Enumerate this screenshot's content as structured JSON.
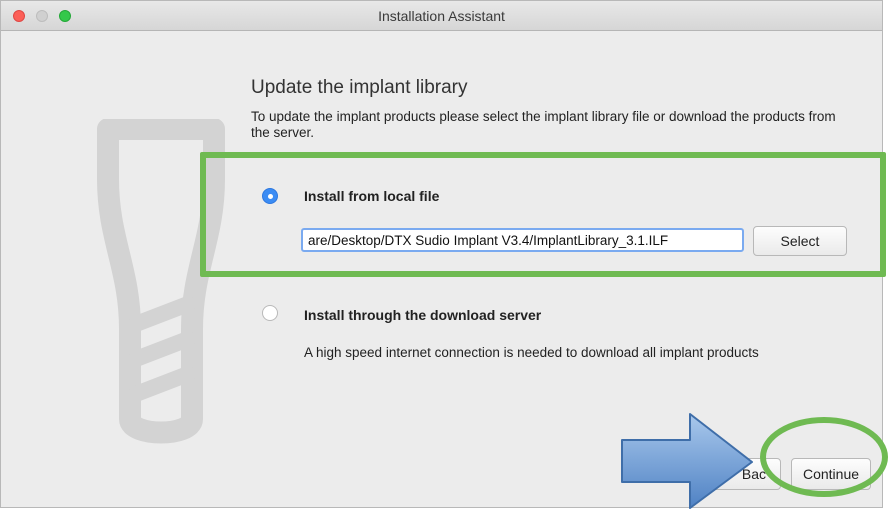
{
  "window": {
    "title": "Installation Assistant"
  },
  "page": {
    "heading": "Update the implant library",
    "description": "To update the implant products please select the implant library file or download the products from the server."
  },
  "options": {
    "local": {
      "label": "Install from local file",
      "selected": true,
      "file_path": "are/Desktop/DTX Sudio Implant V3.4/ImplantLibrary_3.1.ILF",
      "select_label": "Select"
    },
    "server": {
      "label": "Install through the download server",
      "selected": false,
      "description": "A high speed internet connection is needed to download all implant products"
    }
  },
  "footer": {
    "back_label": "Bac",
    "continue_label": "Continue"
  },
  "annotations": {
    "highlight_color": "#6fba52",
    "arrow_color": "#6a9ad6"
  },
  "icons": [
    "close-traffic-light",
    "minimize-traffic-light",
    "maximize-traffic-light",
    "implant-graphic",
    "blue-arrow"
  ]
}
